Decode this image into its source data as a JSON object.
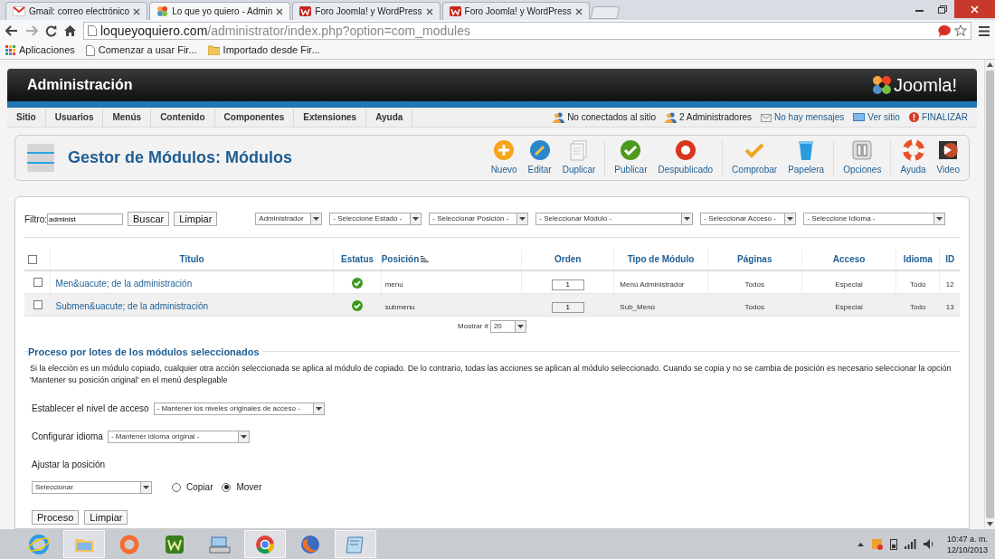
{
  "browser": {
    "tabs": [
      {
        "title": "Gmail: correo electrónico",
        "kind": "gmail",
        "selected": false
      },
      {
        "title": "Lo que yo quiero - Admin",
        "kind": "joomla",
        "selected": true
      },
      {
        "title": "Foro Joomla! y WordPress",
        "kind": "forum",
        "selected": false
      },
      {
        "title": "Foro Joomla! y WordPress",
        "kind": "forum",
        "selected": false
      }
    ],
    "address_host": "loqueyoquiero.com",
    "address_path": "/administrator/index.php?option=com_modules",
    "bookmarks": [
      {
        "label": "Aplicaciones",
        "kind": "apps"
      },
      {
        "label": "Comenzar a usar Fir...",
        "kind": "page"
      },
      {
        "label": "Importado desde Fir...",
        "kind": "folder"
      }
    ]
  },
  "header": {
    "title": "Administración",
    "logo": "Joomla!"
  },
  "menu": [
    "Sitio",
    "Usuarios",
    "Menús",
    "Contenido",
    "Componentes",
    "Extensiones",
    "Ayuda"
  ],
  "status": [
    {
      "label": "No conectados al sitio",
      "kind": "users"
    },
    {
      "label": "2 Administradores",
      "kind": "users"
    },
    {
      "label": "No hay mensajes",
      "kind": "mail"
    },
    {
      "label": "Ver sitio",
      "kind": "screen"
    },
    {
      "label": "FINALIZAR",
      "kind": "logout"
    }
  ],
  "toolbar": {
    "title": "Gestor de Módulos: Módulos",
    "buttons": [
      {
        "label": "Nuevo",
        "kind": "new"
      },
      {
        "label": "Editar",
        "kind": "edit"
      },
      {
        "label": "Duplicar",
        "kind": "copy"
      },
      {
        "label": "Publicar",
        "kind": "publish"
      },
      {
        "label": "Despublicado",
        "kind": "unpublish"
      },
      {
        "label": "Comprobar",
        "kind": "check"
      },
      {
        "label": "Papelera",
        "kind": "trash"
      },
      {
        "label": "Opciones",
        "kind": "options"
      },
      {
        "label": "Ayuda",
        "kind": "help"
      },
      {
        "label": "Video",
        "kind": "video"
      }
    ]
  },
  "filter": {
    "label": "Filtro:",
    "value": "administ",
    "buttons": [
      "Buscar",
      "Limpiar"
    ],
    "selects": [
      "Administrador",
      "- Seleccione Estado -",
      "- Seleccionar Posición -",
      "- Seleccionar Módulo -",
      "- Seleccionar Acceso -",
      "- Seleccione Idioma -"
    ]
  },
  "table": {
    "select_all_checked": false,
    "columns": [
      "Título",
      "Estatus",
      "Posición",
      "Orden",
      "Tipo de Módulo",
      "Páginas",
      "Acceso",
      "Idioma",
      "ID"
    ],
    "rows": [
      {
        "checked": false,
        "title": "Men&uacute; de la administración",
        "published": true,
        "position": "menu",
        "order": "1",
        "type": "Menú Administrador",
        "pages": "Todos",
        "access": "Especial",
        "language": "Todo",
        "id": "12"
      },
      {
        "checked": false,
        "title": "Submen&uacute; de la administración",
        "published": true,
        "position": "submenu",
        "order": "1",
        "type": "Sub_Menú",
        "pages": "Todos",
        "access": "Especial",
        "language": "Todo",
        "id": "13"
      }
    ]
  },
  "pagination": {
    "label": "Mostrar #",
    "value": "20"
  },
  "batch": {
    "legend": "Proceso por lotes de los módulos seleccionados",
    "description": "Si la elección es un módulo copiado, cualquier otra acción seleccionada se aplica al módulo de copiado. De lo contrario, todas las acciones se aplican al módulo seleccionado. Cuando se copia y no se cambia de posición es necesario seleccionar la opción 'Mantener su posición original' en el menú desplegable",
    "access_label": "Establecer el nivel de acceso",
    "access_value": "- Mantener los niveles originales de acceso -",
    "language_label": "Configurar idioma",
    "language_value": "- Mantener idioma original -",
    "position_label": "Ajustar la posición",
    "position_value": "Seleccionar",
    "options": [
      {
        "label": "Copiar",
        "selected": false
      },
      {
        "label": "Mover",
        "selected": true
      }
    ],
    "buttons": [
      "Proceso",
      "Limpiar"
    ]
  },
  "taskbar": {
    "apps": [
      {
        "kind": "ie",
        "active": false
      },
      {
        "kind": "explorer",
        "active": true
      },
      {
        "kind": "origin",
        "active": false
      },
      {
        "kind": "w",
        "active": false
      },
      {
        "kind": "keyboard",
        "active": false
      },
      {
        "kind": "chrome",
        "active": true
      },
      {
        "kind": "firefox",
        "active": false
      },
      {
        "kind": "notes",
        "active": true
      }
    ],
    "time": "10:47 a. m.",
    "date": "12/10/2013"
  }
}
